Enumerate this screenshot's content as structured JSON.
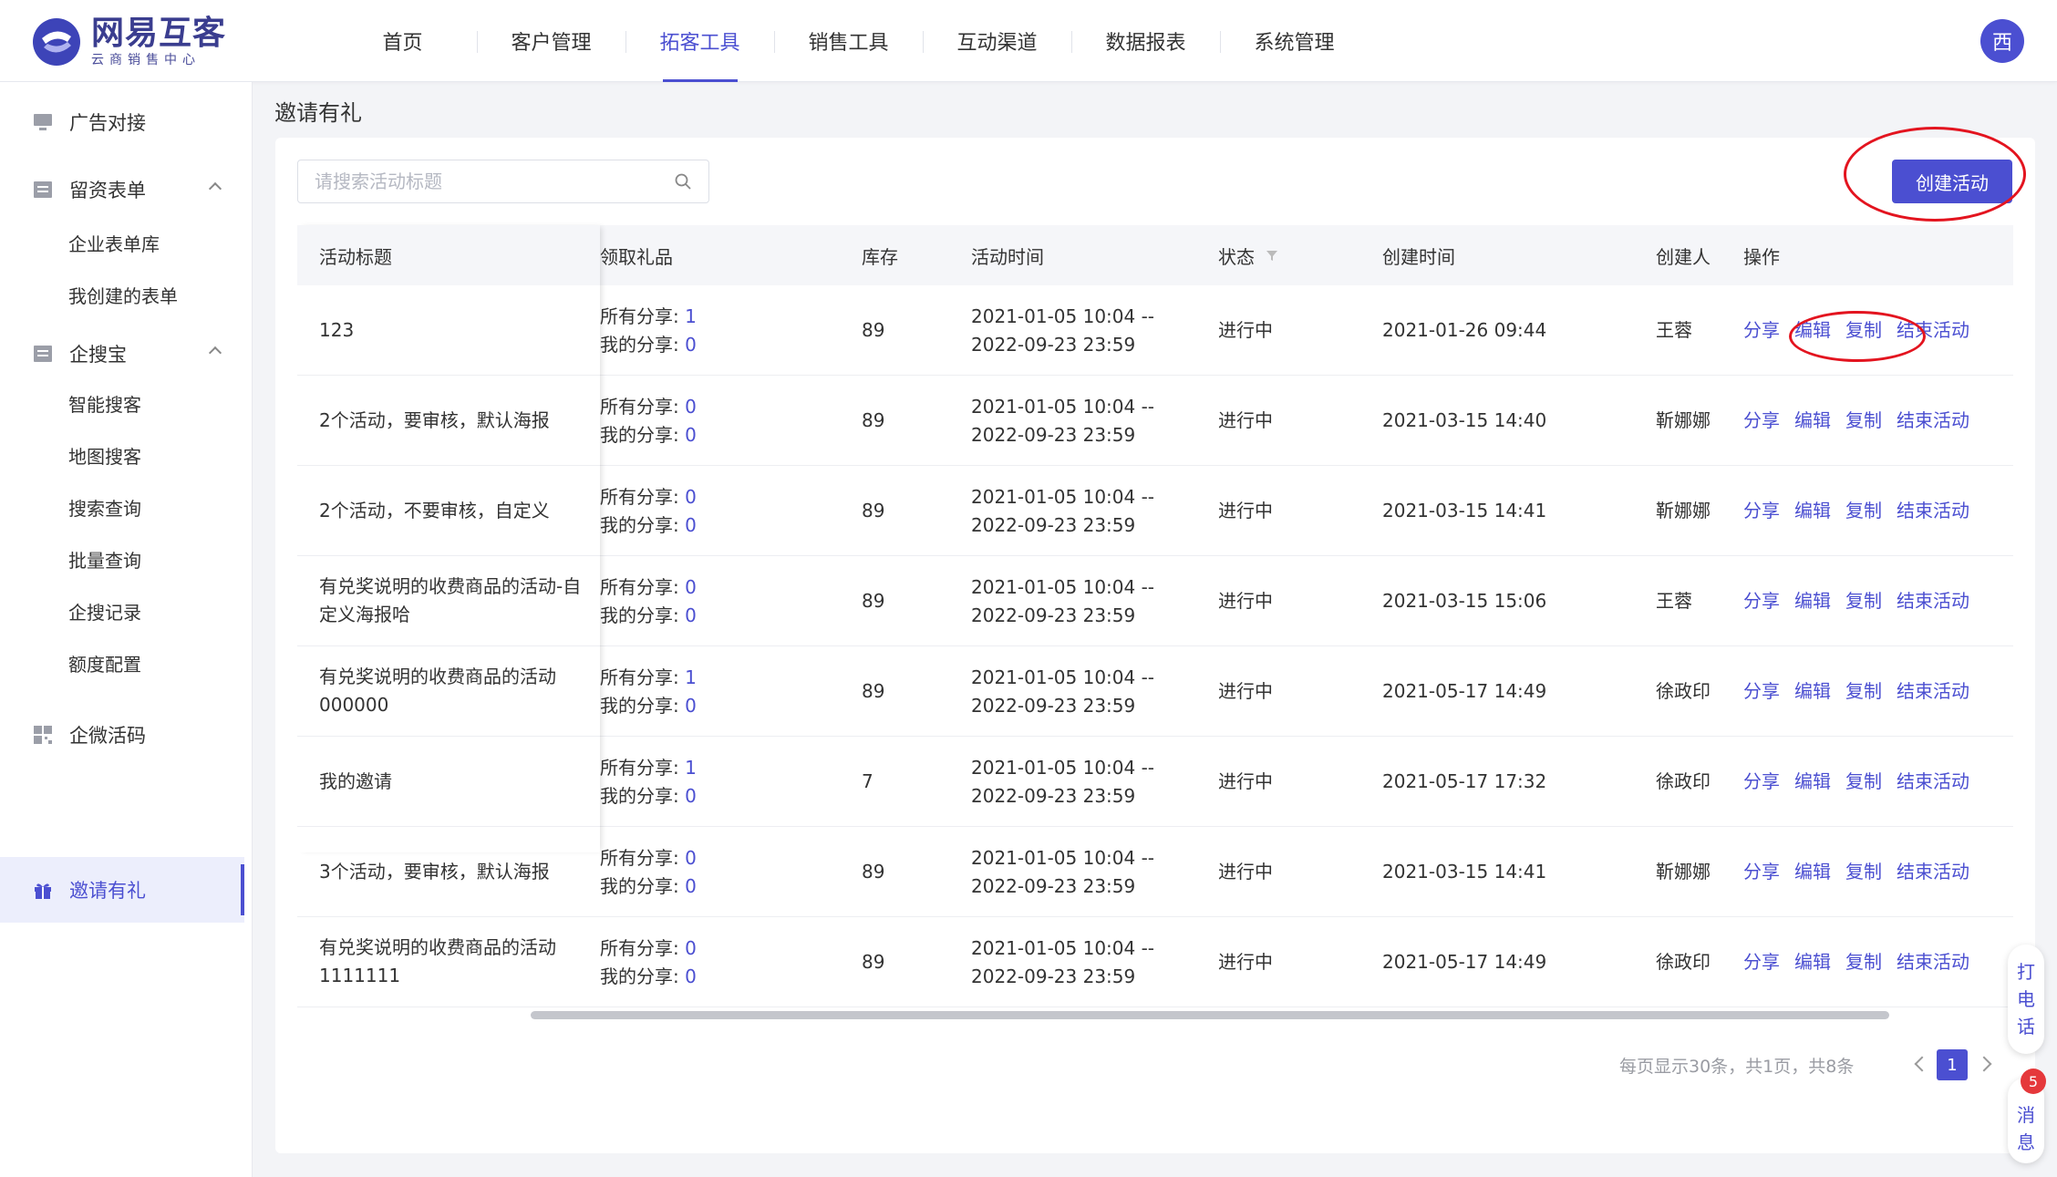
{
  "header": {
    "logo_title": "网易互客",
    "logo_subtitle": "云商销售中心",
    "nav": [
      {
        "label": "首页"
      },
      {
        "label": "客户管理"
      },
      {
        "label": "拓客工具"
      },
      {
        "label": "销售工具"
      },
      {
        "label": "互动渠道"
      },
      {
        "label": "数据报表"
      },
      {
        "label": "系统管理"
      }
    ],
    "active_nav": "拓客工具",
    "avatar_text": "西"
  },
  "sidebar": {
    "ad": "广告对接",
    "leads_form": "留资表单",
    "leads_sub": [
      "企业表单库",
      "我创建的表单"
    ],
    "qisoubao": "企搜宝",
    "qisoubao_sub": [
      "智能搜客",
      "地图搜客",
      "搜索查询",
      "批量查询",
      "企搜记录",
      "额度配置"
    ],
    "wecom_qr": "企微活码",
    "invite": "邀请有礼"
  },
  "page": {
    "title": "邀请有礼",
    "search_placeholder": "请搜索活动标题",
    "create_button": "创建活动"
  },
  "table": {
    "headers": {
      "title": "活动标题",
      "gift": "领取礼品",
      "stock": "库存",
      "time": "活动时间",
      "status": "状态",
      "created": "创建时间",
      "creator": "创建人",
      "ops": "操作"
    },
    "gift_labels": {
      "all": "所有分享: ",
      "mine": "我的分享: "
    },
    "ops_labels": {
      "share": "分享",
      "edit": "编辑",
      "copy": "复制",
      "end": "结束活动"
    },
    "rows": [
      {
        "title": "123",
        "all": "1",
        "mine": "0",
        "stock": "89",
        "start": "2021-01-05 10:04 --",
        "end": "2022-09-23 23:59",
        "status": "进行中",
        "created": "2021-01-26 09:44",
        "creator": "王蓉"
      },
      {
        "title": "2个活动，要审核，默认海报",
        "all": "0",
        "mine": "0",
        "stock": "89",
        "start": "2021-01-05 10:04 --",
        "end": "2022-09-23 23:59",
        "status": "进行中",
        "created": "2021-03-15 14:40",
        "creator": "靳娜娜"
      },
      {
        "title": "2个活动，不要审核，自定义",
        "all": "0",
        "mine": "0",
        "stock": "89",
        "start": "2021-01-05 10:04 --",
        "end": "2022-09-23 23:59",
        "status": "进行中",
        "created": "2021-03-15 14:41",
        "creator": "靳娜娜"
      },
      {
        "title": "有兑奖说明的收费商品的活动-自定义海报哈",
        "all": "0",
        "mine": "0",
        "stock": "89",
        "start": "2021-01-05 10:04 --",
        "end": "2022-09-23 23:59",
        "status": "进行中",
        "created": "2021-03-15 15:06",
        "creator": "王蓉"
      },
      {
        "title": "有兑奖说明的收费商品的活动000000",
        "all": "1",
        "mine": "0",
        "stock": "89",
        "start": "2021-01-05 10:04 --",
        "end": "2022-09-23 23:59",
        "status": "进行中",
        "created": "2021-05-17 14:49",
        "creator": "徐政印"
      },
      {
        "title": "我的邀请",
        "all": "1",
        "mine": "0",
        "stock": "7",
        "start": "2021-01-05 10:04 --",
        "end": "2022-09-23 23:59",
        "status": "进行中",
        "created": "2021-05-17 17:32",
        "creator": "徐政印"
      },
      {
        "title": "3个活动，要审核，默认海报",
        "all": "0",
        "mine": "0",
        "stock": "89",
        "start": "2021-01-05 10:04 --",
        "end": "2022-09-23 23:59",
        "status": "进行中",
        "created": "2021-03-15 14:41",
        "creator": "靳娜娜"
      },
      {
        "title": "有兑奖说明的收费商品的活动1111111",
        "all": "0",
        "mine": "0",
        "stock": "89",
        "start": "2021-01-05 10:04 --",
        "end": "2022-09-23 23:59",
        "status": "进行中",
        "created": "2021-05-17 14:49",
        "creator": "徐政印"
      }
    ]
  },
  "pagination": {
    "info": "每页显示30条，共1页，共8条",
    "current": "1"
  },
  "float": {
    "call": [
      "打",
      "电",
      "话"
    ],
    "msg": [
      "消",
      "息"
    ],
    "badge": "5"
  },
  "colors": {
    "accent": "#4b4fd1",
    "annotation_ring": "#e3141f"
  }
}
